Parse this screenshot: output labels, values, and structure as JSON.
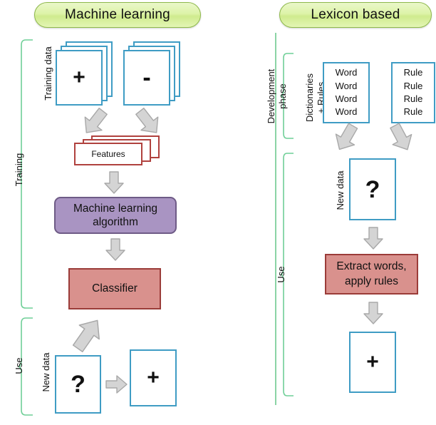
{
  "diagram": {
    "title_left": "Machine learning",
    "title_right": "Lexicon based",
    "colors": {
      "pill_fill": "#ddf3a8",
      "pill_border": "#8db84a",
      "doc_border": "#3f9cc4",
      "card_border": "#b0413e",
      "ml_fill": "#a994c2",
      "ml_border": "#6e5b86",
      "red_fill": "#d9918d",
      "red_border": "#9b3c39",
      "bracket": "#6fcf97",
      "arrow_fill": "#d4d4d4",
      "arrow_border": "#a8a8a8"
    }
  },
  "left": {
    "bracket_training": "Training",
    "bracket_use": "Use",
    "label_training_data": "Training data",
    "label_new_data": "New data",
    "positive_doc": "+",
    "negative_doc": "-",
    "features_card": "Features",
    "ml_algorithm": "Machine learning algorithm",
    "ml_algorithm_line1": "Machine learning",
    "ml_algorithm_line2": "algorithm",
    "classifier": "Classifier",
    "unknown_doc": "?",
    "result_doc": "+"
  },
  "right": {
    "bracket_development_line1": "Development",
    "bracket_development_line2": "phase",
    "bracket_use": "Use",
    "label_dictionaries_line1": "Dictionaries",
    "label_dictionaries_line2": "+ Rules",
    "label_new_data": "New data",
    "words_box": [
      "Word",
      "Word",
      "Word",
      "Word"
    ],
    "rules_box": [
      "Rule",
      "Rule",
      "Rule",
      "Rule"
    ],
    "unknown_doc": "?",
    "extract_box_line1": "Extract words,",
    "extract_box_line2": "apply rules",
    "result_doc": "+"
  }
}
